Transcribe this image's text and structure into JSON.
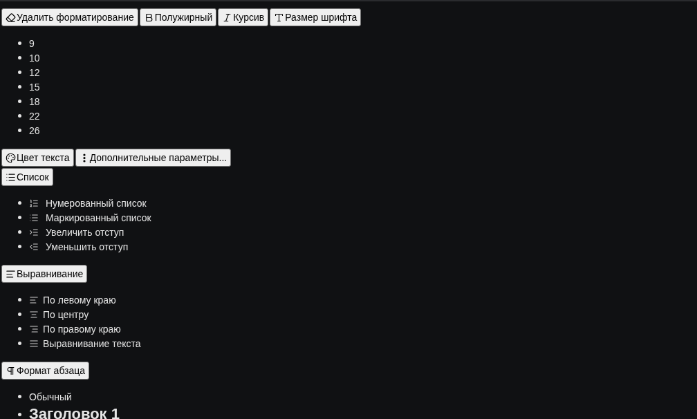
{
  "toolbar": [
    "Удалить форматирование",
    "Полужирный",
    "Курсив",
    "Размер шрифта"
  ],
  "font_sizes": [
    "9",
    "10",
    "12",
    "15",
    "18",
    "22",
    "26"
  ],
  "toolbar_2": [
    "Цвет текста",
    "Дополнительные параметры..."
  ],
  "list_button": "Список",
  "list_options": [
    "Нумерованный список",
    "Маркированный список",
    "Увеличить отступ",
    "Уменьшить отступ"
  ],
  "align_button": "Выравнивание",
  "align_options": [
    "По левому краю",
    "По центру",
    "По правому краю",
    "Выравнивание текста"
  ],
  "paragraph_button": "Формат абзаца",
  "paragraph_formats": [
    {
      "label": "Обычный",
      "kind": "normal"
    },
    {
      "label": "Заголовок 1",
      "kind": "heading1"
    }
  ]
}
